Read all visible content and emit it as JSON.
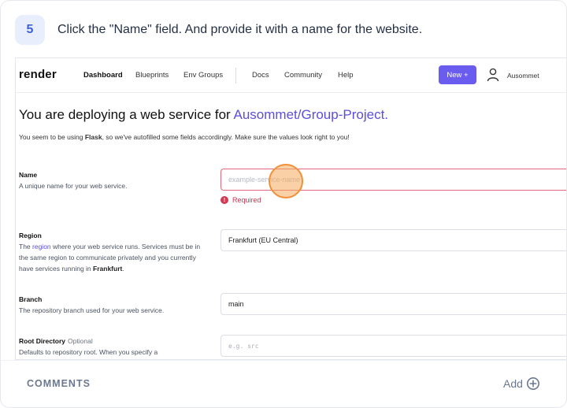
{
  "step": {
    "number": "5",
    "instruction": "Click the \"Name\" field. And provide it with a name for the website."
  },
  "topbar": {
    "logo": "render",
    "nav": [
      "Dashboard",
      "Blueprints",
      "Env Groups",
      "Docs",
      "Community",
      "Help"
    ],
    "active_nav": "Dashboard",
    "new_button": "New +",
    "user_name": "Ausommet"
  },
  "deploy": {
    "title_prefix": "You are deploying a web service for ",
    "repo": "Ausommet/Group-Project.",
    "sub_before": "You seem to be using ",
    "framework": "Flask",
    "sub_after": ", so we've autofilled some fields accordingly. Make sure the values look right to you!"
  },
  "fields": {
    "name": {
      "label": "Name",
      "description": "A unique name for your web service.",
      "placeholder": "example-service-name",
      "error": "Required"
    },
    "region": {
      "label": "Region",
      "desc_before": "The ",
      "desc_link": "region",
      "desc_middle": " where your web service runs. Services must be in the same region to communicate privately and you currently have services running in ",
      "desc_bold": "Frankfurt",
      "desc_end": ".",
      "value": "Frankfurt (EU Central)"
    },
    "branch": {
      "label": "Branch",
      "description": "The repository branch used for your web service.",
      "value": "main"
    },
    "root_directory": {
      "label": "Root Directory",
      "optional": "Optional",
      "description": "Defaults to repository root. When you specify a",
      "placeholder": "e.g. src"
    }
  },
  "footer": {
    "comments": "COMMENTS",
    "add": "Add"
  },
  "colors": {
    "accent": "#6b5cf0",
    "link": "#5a4fdb",
    "error": "#c9374f",
    "marker": "#f0913a",
    "badge_bg": "#e8eefc"
  }
}
